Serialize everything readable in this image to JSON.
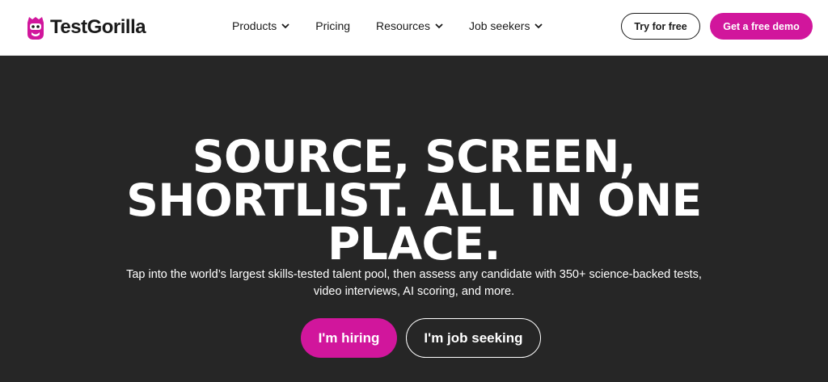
{
  "brand": {
    "name": "TestGorilla",
    "logo_icon": "gorilla-icon",
    "accent_color": "#d1169c"
  },
  "nav": {
    "items": [
      {
        "label": "Products",
        "has_dropdown": true
      },
      {
        "label": "Pricing",
        "has_dropdown": false
      },
      {
        "label": "Resources",
        "has_dropdown": true
      },
      {
        "label": "Job seekers",
        "has_dropdown": true
      }
    ],
    "try_free_label": "Try for free",
    "demo_label": "Get a free demo"
  },
  "hero": {
    "title_lines": [
      "SOURCE, SCREEN,",
      "SHORTLIST.  ALL IN ONE",
      "PLACE."
    ],
    "subtitle_lines": [
      "Tap into the world’s largest skills-tested talent pool, then assess any candidate with 350+ science-backed tests,",
      "video interviews, AI scoring, and more."
    ],
    "primary_cta": "I'm hiring",
    "secondary_cta": "I'm job seeking",
    "background_color": "#262626"
  }
}
